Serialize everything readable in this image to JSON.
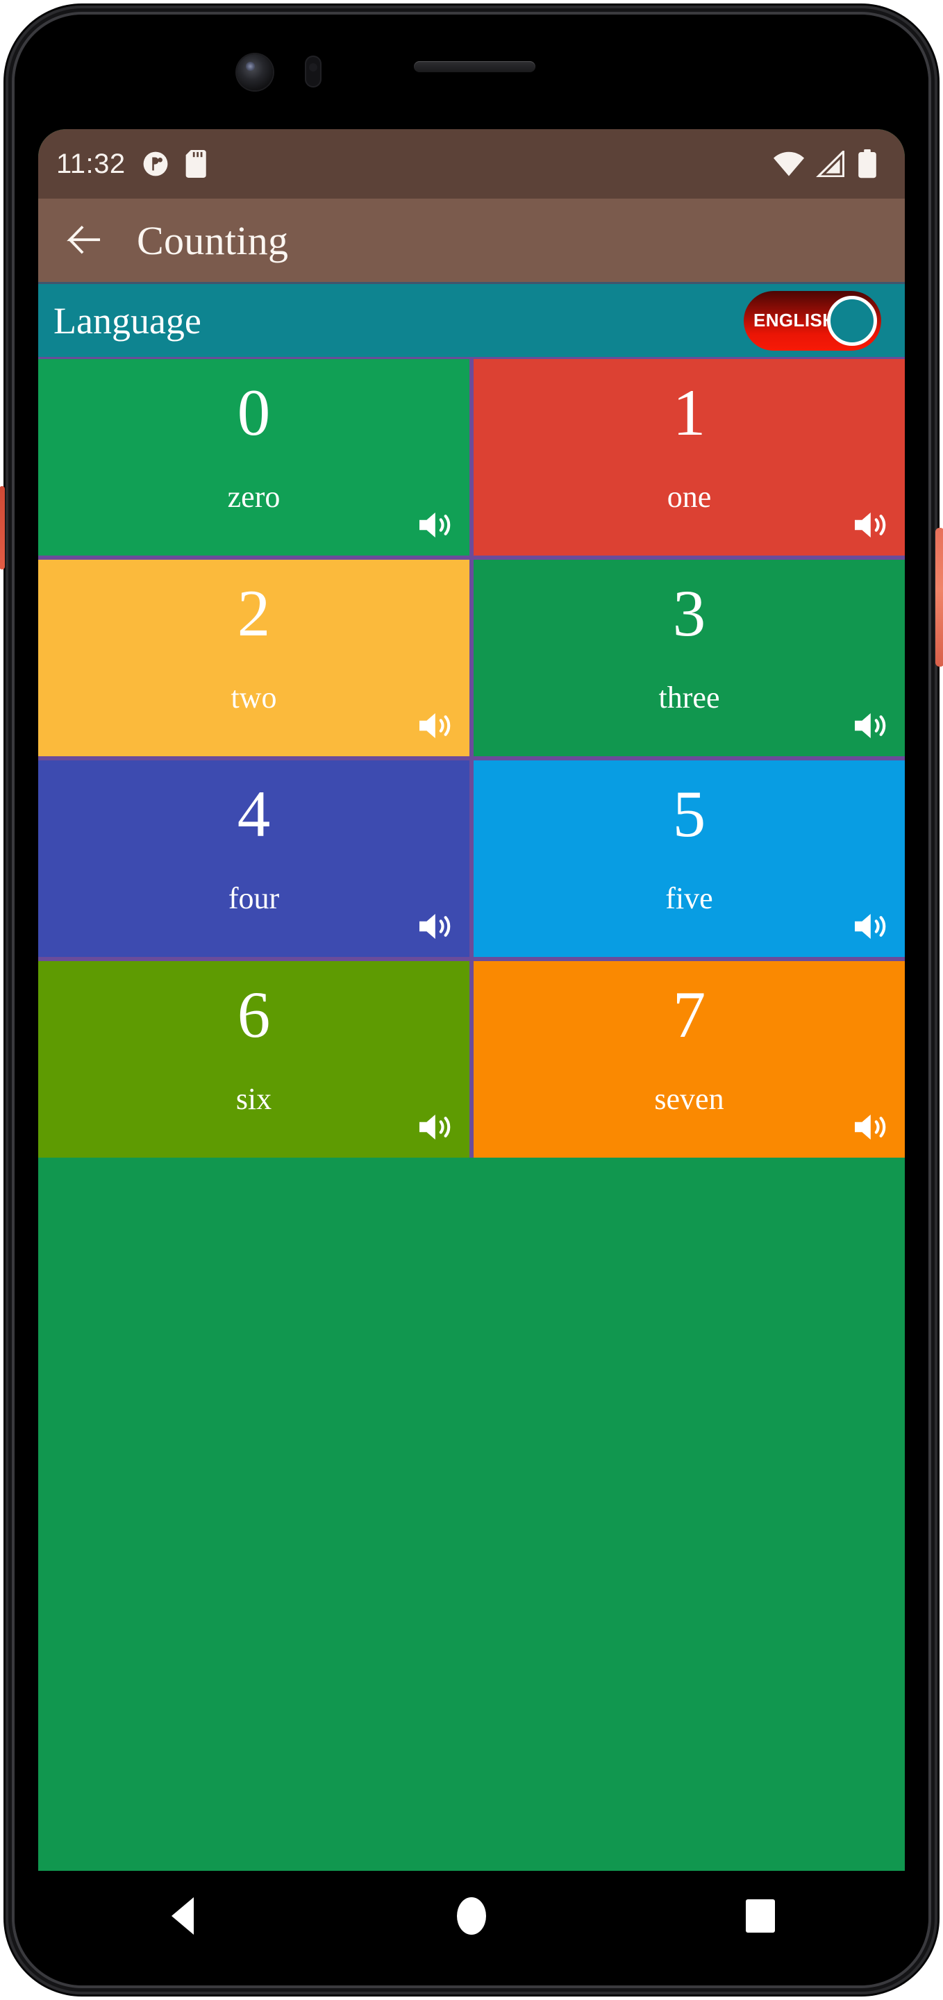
{
  "status_bar": {
    "time": "11:32",
    "icons_left": [
      "do-not-disturb-icon",
      "sd-card-icon"
    ],
    "icons_right": [
      "wifi-icon",
      "cellular-signal-icon",
      "battery-icon"
    ],
    "background_color": "#5C4238"
  },
  "app_bar": {
    "back_label": "back-arrow-icon",
    "title": "Counting",
    "background_color": "#7B5B4D"
  },
  "language_bar": {
    "label": "Language",
    "toggle_value": "ENGLISH",
    "toggle_on": true,
    "background_color": "#0E8490",
    "toggle_color": "#EA1505"
  },
  "grid": {
    "tiles": [
      {
        "number": "0",
        "word": "zero",
        "color": "#11A055",
        "speaker": "speaker-icon"
      },
      {
        "number": "1",
        "word": "one",
        "color": "#DC4133",
        "speaker": "speaker-icon"
      },
      {
        "number": "2",
        "word": "two",
        "color": "#FBBA3C",
        "speaker": "speaker-icon"
      },
      {
        "number": "3",
        "word": "three",
        "color": "#11974F",
        "speaker": "speaker-icon"
      },
      {
        "number": "4",
        "word": "four",
        "color": "#3D4BB0",
        "speaker": "speaker-icon"
      },
      {
        "number": "5",
        "word": "five",
        "color": "#089DE3",
        "speaker": "speaker-icon"
      },
      {
        "number": "6",
        "word": "six",
        "color": "#5E9B02",
        "speaker": "speaker-icon"
      },
      {
        "number": "7",
        "word": "seven",
        "color": "#FA8901",
        "speaker": "speaker-icon"
      }
    ],
    "divider_color": "#6B4C9A"
  },
  "nav_bar": {
    "back": "triangle-back-icon",
    "home": "circle-home-icon",
    "recents": "square-recents-icon"
  }
}
